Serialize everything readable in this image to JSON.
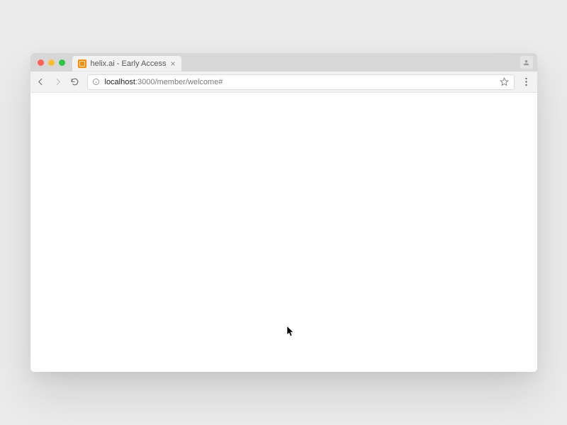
{
  "tab": {
    "title": "helix.ai - Early Access",
    "close_glyph": "×"
  },
  "toolbar": {
    "new_tab_glyph": "",
    "url_host": "localhost",
    "url_port_path": ":3000/member/welcome#"
  }
}
